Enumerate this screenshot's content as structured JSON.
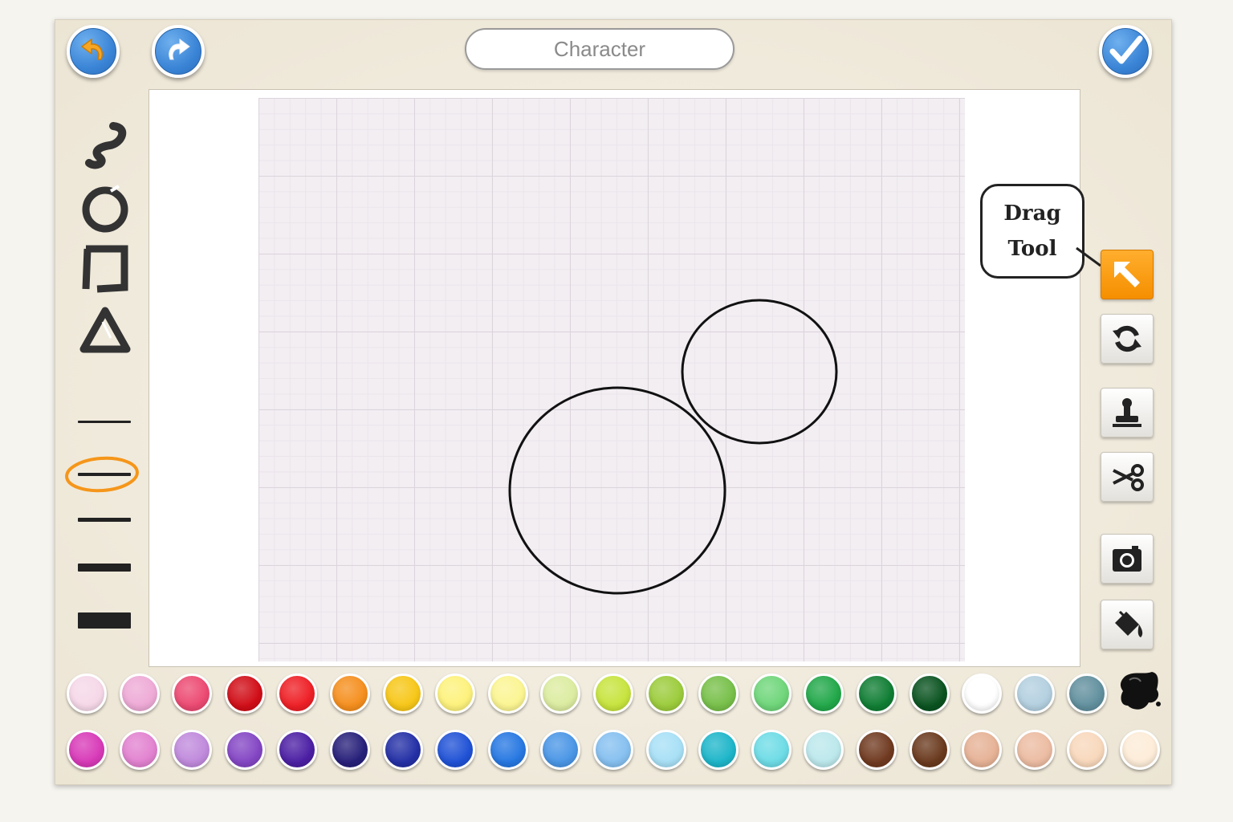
{
  "header": {
    "title": "Character"
  },
  "tooltip": {
    "line1": "Drag",
    "line2": "Tool"
  },
  "toolbar_left": {
    "shapes": [
      "freehand-icon",
      "circle-icon",
      "rectangle-icon",
      "triangle-icon"
    ],
    "stroke_widths_selected_index": 1
  },
  "toolbar_right": {
    "tools": [
      "drag-icon",
      "rotate-icon",
      "stamp-icon",
      "scissors-icon",
      "camera-icon",
      "paint-bucket-icon"
    ],
    "active_tool": "drag-icon"
  },
  "colors": {
    "accent": "#f5961a",
    "button_blue": "#3a84d6"
  },
  "palette": {
    "row1": [
      "#f6d8e8",
      "#eeaad6",
      "#ec4a72",
      "#d10e18",
      "#ee2026",
      "#f58f1e",
      "#f7c718",
      "#fdf27c",
      "#fbf592",
      "#dceca0",
      "#c7e43e",
      "#9ccc3c",
      "#78c04a",
      "#6fd67a",
      "#22a84a",
      "#107e34",
      "#0a5320",
      "#ffffff",
      "#b4d0e0",
      "#62909e"
    ],
    "row2": [
      "#d83ab8",
      "#e282d0",
      "#c08adc",
      "#8446c4",
      "#4c1fa4",
      "#27207a",
      "#2430a6",
      "#2052d6",
      "#2778e2",
      "#4a96e6",
      "#86c0f0",
      "#a8e0f6",
      "#1eb6ca",
      "#6edce6",
      "#bce8ec",
      "#703a20",
      "#6a3a1e",
      "#e6b296",
      "#ecbca2",
      "#f8d8bc",
      "#fdecd8"
    ]
  }
}
